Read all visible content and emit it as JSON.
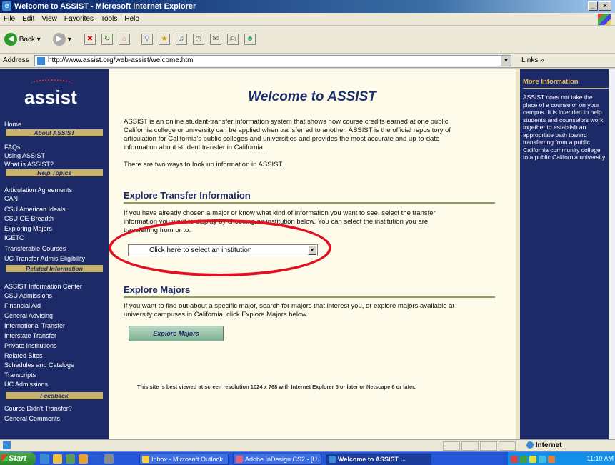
{
  "window": {
    "title": "Welcome to ASSIST - Microsoft Internet Explorer",
    "controls": [
      "_",
      "×"
    ]
  },
  "menu": [
    "File",
    "Edit",
    "View",
    "Favorites",
    "Tools",
    "Help"
  ],
  "toolbar": {
    "back_label": "Back"
  },
  "address": {
    "label": "Address",
    "url": "http://www.assist.org/web-assist/welcome.html",
    "links_label": "Links »"
  },
  "left_nav": {
    "logo": "assist",
    "home": "Home",
    "about_header": "About ASSIST",
    "about_items": [
      "FAQs",
      "Using ASSIST",
      "What is ASSIST?"
    ],
    "help_header": "Help Topics",
    "help_items": [
      "Articulation Agreements",
      "CAN",
      "CSU American Ideals",
      "CSU GE-Breadth",
      "Exploring Majors",
      "IGETC",
      "Transferable Courses",
      "UC Transfer Admis Eligibility"
    ],
    "related_header": "Related Information",
    "related_items": [
      "ASSIST Information Center",
      "CSU Admissions",
      "Financial Aid",
      "General Advising",
      "International Transfer",
      "Interstate Transfer",
      "Private Institutions",
      "Related Sites",
      "Schedules and Catalogs",
      "Transcripts",
      "UC Admissions"
    ],
    "feedback_header": "Feedback",
    "feedback_items": [
      "Course Didn't Transfer?",
      "General Comments"
    ]
  },
  "main": {
    "title": "Welcome to ASSIST",
    "intro": "ASSIST is an online student-transfer information system that shows how course credits earned at one public California college or university can be applied when transferred to another. ASSIST is the official repository of articulation for California's public colleges and universities and provides the most accurate and up-to-date information about student transfer in California.",
    "ways": "There are two ways to look up information in ASSIST.",
    "explore_transfer_title": "Explore Transfer Information",
    "explore_transfer_text": "If you have already chosen a major or know what kind of information you want to see, select the transfer information you want to display by choosing an institution below. You can select the institution you are transferring from or to.",
    "select_placeholder": "Click here to select an institution",
    "explore_majors_title": "Explore Majors",
    "explore_majors_text": "If you want to find out about a specific major, search for majors that interest you, or explore majors available at university campuses in California, click Explore Majors below.",
    "explore_majors_button": "Explore Majors",
    "footer_note": "This site is best viewed at screen resolution 1024 x 768 with Internet Explorer 5 or later or Netscape 6 or later."
  },
  "right_nav": {
    "header": "More Information",
    "text": "ASSIST does not take the place of a counselor on your campus. It is intended to help students and counselors work together to establish an appropriate path toward transferring from a public California community college to a public California university."
  },
  "status_bar": {
    "zone": "Internet"
  },
  "taskbar": {
    "start": "Start",
    "tasks": [
      "Inbox - Microsoft Outlook",
      "Adobe InDesign CS2 - [U...",
      "Welcome to ASSIST ..."
    ],
    "clock": "11:10 AM"
  },
  "colors": {
    "nav_bg": "#1c2a68",
    "nav_header": "#c7b36b",
    "main_bg": "#fffbea",
    "highlight_oval": "#e01020"
  }
}
